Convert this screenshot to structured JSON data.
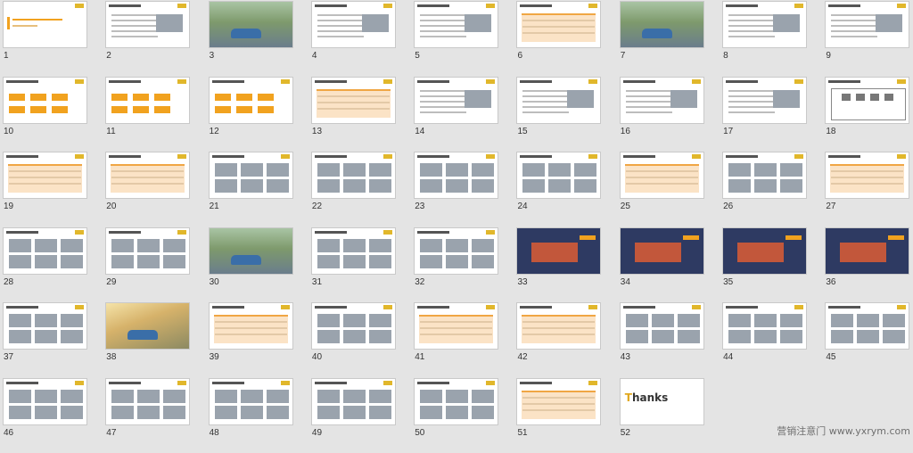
{
  "slide_numbers": [
    "1",
    "2",
    "3",
    "4",
    "5",
    "6",
    "7",
    "8",
    "9",
    "10",
    "11",
    "12",
    "13",
    "14",
    "15",
    "16",
    "17",
    "18",
    "19",
    "20",
    "21",
    "22",
    "23",
    "24",
    "25",
    "26",
    "27",
    "28",
    "29",
    "30",
    "31",
    "32",
    "33",
    "34",
    "35",
    "36",
    "37",
    "38",
    "39",
    "40",
    "41",
    "42",
    "43",
    "44",
    "45",
    "46",
    "47",
    "48",
    "49",
    "50",
    "51",
    "52"
  ],
  "slide_types": [
    "title",
    "agenda",
    "photo",
    "text",
    "text",
    "table",
    "photo",
    "text",
    "text",
    "flow",
    "flow",
    "flow",
    "table",
    "text",
    "text",
    "text",
    "text",
    "diagram",
    "table",
    "table",
    "images",
    "images",
    "images",
    "images",
    "table",
    "images",
    "table",
    "images",
    "images",
    "photo",
    "images",
    "images",
    "game",
    "game",
    "game",
    "game",
    "images",
    "photo",
    "table",
    "images",
    "table",
    "table",
    "images",
    "images",
    "images",
    "images",
    "images",
    "images",
    "images",
    "images",
    "table",
    "thanks"
  ],
  "thanks_slide": {
    "t_letter": "T",
    "rest": "hanks"
  },
  "watermark": "营销注意门 www.yxrym.com",
  "colors": {
    "background": "#e4e4e4",
    "accent": "#f1a21f",
    "logo": "#e1b72b"
  }
}
